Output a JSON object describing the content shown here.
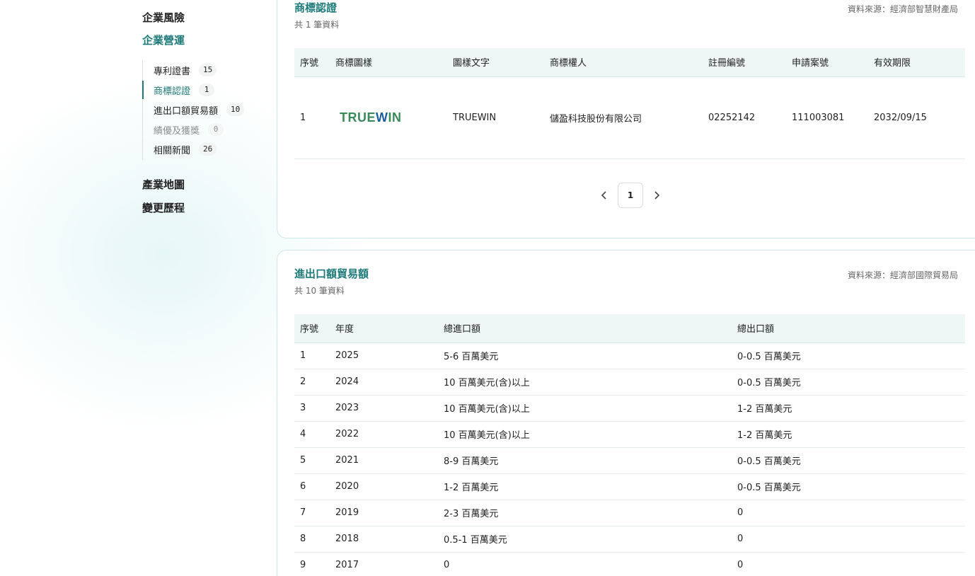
{
  "sidebar": {
    "top_items": [
      {
        "label": "企業風險"
      },
      {
        "label": "企業營運"
      }
    ],
    "sub_items": [
      {
        "label": "專利證書",
        "count": "15"
      },
      {
        "label": "商標認證",
        "count": "1"
      },
      {
        "label": "進出口額貿易額",
        "count": "10"
      },
      {
        "label": "績優及獲獎",
        "count": "0"
      },
      {
        "label": "相關新聞",
        "count": "26"
      }
    ],
    "bottom_items": [
      {
        "label": "產業地圖"
      },
      {
        "label": "變更歷程"
      }
    ]
  },
  "trademark": {
    "title": "商標認證",
    "count_text": "共 1 筆資料",
    "source": "資料來源：經濟部智慧財產局",
    "headers": [
      "序號",
      "商標圖樣",
      "圖樣文字",
      "商標權人",
      "註冊編號",
      "申請案號",
      "有效期限"
    ],
    "rows": [
      {
        "no": "1",
        "logo_text": "TRUEWIN",
        "text": "TRUEWIN",
        "owner": "儲盈科技股份有限公司",
        "reg_no": "02252142",
        "app_no": "111003081",
        "expiry": "2032/09/15"
      }
    ],
    "pagination": {
      "current_page": "1",
      "prev_icon": "chevron-left-icon",
      "next_icon": "chevron-right-icon"
    }
  },
  "trade": {
    "title": "進出口額貿易額",
    "count_text": "共 10 筆資料",
    "source": "資料來源：經濟部國際貿易局",
    "headers": [
      "序號",
      "年度",
      "總進口額",
      "總出口額"
    ],
    "rows": [
      {
        "no": "1",
        "year": "2025",
        "import": "5-6 百萬美元",
        "export": "0-0.5 百萬美元"
      },
      {
        "no": "2",
        "year": "2024",
        "import": "10 百萬美元(含)以上",
        "export": "0-0.5 百萬美元"
      },
      {
        "no": "3",
        "year": "2023",
        "import": "10 百萬美元(含)以上",
        "export": "1-2 百萬美元"
      },
      {
        "no": "4",
        "year": "2022",
        "import": "10 百萬美元(含)以上",
        "export": "1-2 百萬美元"
      },
      {
        "no": "5",
        "year": "2021",
        "import": "8-9 百萬美元",
        "export": "0-0.5 百萬美元"
      },
      {
        "no": "6",
        "year": "2020",
        "import": "1-2 百萬美元",
        "export": "0-0.5 百萬美元"
      },
      {
        "no": "7",
        "year": "2019",
        "import": "2-3 百萬美元",
        "export": "0"
      },
      {
        "no": "8",
        "year": "2018",
        "import": "0.5-1 百萬美元",
        "export": "0"
      },
      {
        "no": "9",
        "year": "2017",
        "import": "0",
        "export": "0"
      }
    ]
  },
  "colors": {
    "accent": "#1d7a78",
    "header_bg": "#eef6f6",
    "logo_green": "#3a8a5a",
    "logo_blue": "#1e5fa0"
  }
}
